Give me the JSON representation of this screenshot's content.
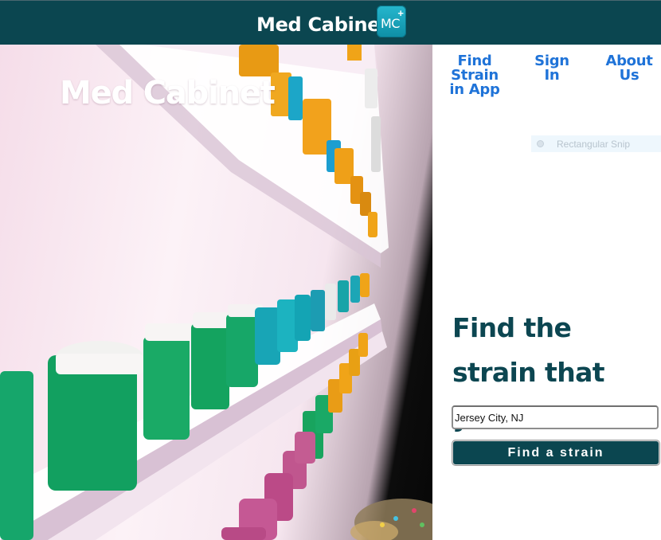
{
  "header": {
    "title": "Med Cabinet",
    "logo_text": "MC",
    "logo_badge": "+"
  },
  "hero": {
    "title": "Med Cabinet",
    "image": "pill-bottles-shelves-photo"
  },
  "nav": {
    "find_strain": "Find Strain in App",
    "sign_in": "Sign In",
    "about_us": "About Us"
  },
  "snip_overlay": {
    "label": "Rectangular Snip"
  },
  "search": {
    "headline": "Find the strain that you need",
    "location_value": "Jersey City, NJ",
    "button_label": "Find a strain"
  },
  "colors": {
    "brand_dark": "#0b4650",
    "link_blue": "#1f73d8",
    "headline": "#0c4651",
    "logo_teal": "#1aa6bd"
  }
}
